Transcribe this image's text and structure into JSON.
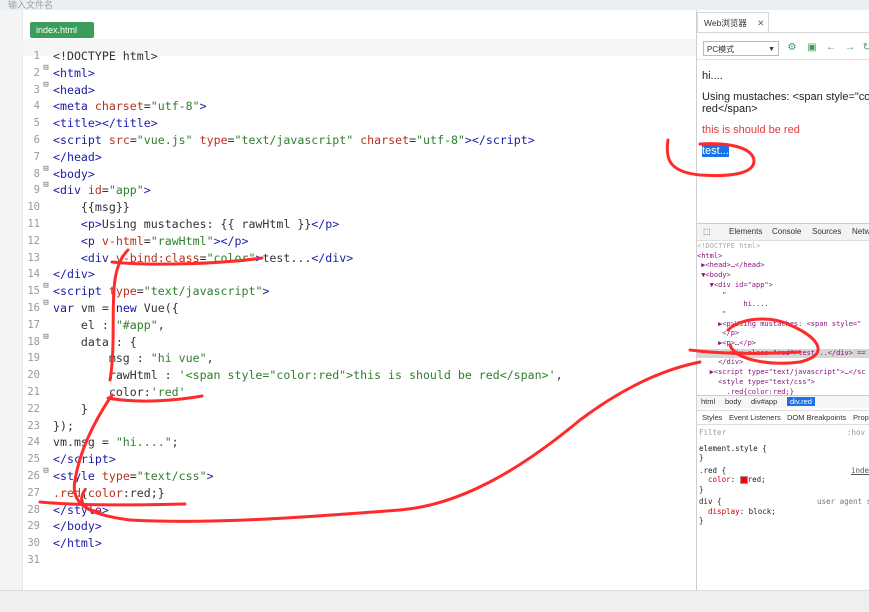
{
  "window": {
    "top_strip_text": "输入文件名"
  },
  "editor": {
    "tab_label": "index.html",
    "lines": [
      {
        "n": "1",
        "fold": "",
        "html": "&lt;!DOCTYPE html&gt;"
      },
      {
        "n": "2",
        "fold": "⊟",
        "html": "<span class='t'>&lt;html&gt;</span>"
      },
      {
        "n": "3",
        "fold": "⊟",
        "html": "<span class='t'>&lt;head&gt;</span>"
      },
      {
        "n": "4",
        "fold": "",
        "html": "<span class='t'>&lt;meta</span> <span class='a'>charset</span>=<span class='s'>\"utf-8\"</span><span class='t'>&gt;</span>"
      },
      {
        "n": "5",
        "fold": "",
        "html": "<span class='t'>&lt;title&gt;&lt;/title&gt;</span>"
      },
      {
        "n": "6",
        "fold": "",
        "html": "<span class='t'>&lt;script</span> <span class='a'>src</span>=<span class='s'>\"vue.js\"</span> <span class='a'>type</span>=<span class='s'>\"text/javascript\"</span> <span class='a'>charset</span>=<span class='s'>\"utf-8\"</span><span class='t'>&gt;&lt;/script&gt;</span>"
      },
      {
        "n": "7",
        "fold": "",
        "html": "<span class='t'>&lt;/head&gt;</span>"
      },
      {
        "n": "8",
        "fold": "⊟",
        "html": "<span class='t'>&lt;body&gt;</span>"
      },
      {
        "n": "9",
        "fold": "⊟",
        "html": "<span class='t'>&lt;div</span> <span class='a'>id</span>=<span class='s'>\"app\"</span><span class='t'>&gt;</span>"
      },
      {
        "n": "10",
        "fold": "",
        "html": "    {{msg}}"
      },
      {
        "n": "11",
        "fold": "",
        "html": "    <span class='t'>&lt;p&gt;</span>Using mustaches: {{ rawHtml }}<span class='t'>&lt;/p&gt;</span>"
      },
      {
        "n": "12",
        "fold": "",
        "html": "    <span class='t'>&lt;p</span> <span class='a'>v-html</span>=<span class='s'>\"rawHtml\"</span><span class='t'>&gt;&lt;/p&gt;</span>"
      },
      {
        "n": "13",
        "fold": "",
        "html": "    <span class='t'>&lt;div</span> <span class='a'>v-bind:class</span>=<span class='s'>\"color\"</span><span class='t'>&gt;</span>test...<span class='t'>&lt;/div&gt;</span>"
      },
      {
        "n": "14",
        "fold": "",
        "html": "<span class='t'>&lt;/div&gt;</span>"
      },
      {
        "n": "15",
        "fold": "⊟",
        "html": "<span class='t'>&lt;script</span> <span class='a'>type</span>=<span class='s'>\"text/javascript\"</span><span class='t'>&gt;</span>"
      },
      {
        "n": "16",
        "fold": "⊟",
        "html": "<span class='k'>var</span> vm = <span class='k'>new</span> Vue({"
      },
      {
        "n": "17",
        "fold": "",
        "html": "    el : <span class='s'>\"#app\"</span>,"
      },
      {
        "n": "18",
        "fold": "⊟",
        "html": "    data : {"
      },
      {
        "n": "19",
        "fold": "",
        "html": "        msg : <span class='s'>\"hi vue\"</span>,"
      },
      {
        "n": "20",
        "fold": "",
        "html": "        rawHtml : <span class='s'>'&lt;span style=\"color:red\"&gt;this is should be red&lt;/span&gt;'</span>,"
      },
      {
        "n": "21",
        "fold": "",
        "html": "        color:<span class='s'>'red'</span>"
      },
      {
        "n": "22",
        "fold": "",
        "html": "    }"
      },
      {
        "n": "23",
        "fold": "",
        "html": "});"
      },
      {
        "n": "24",
        "fold": "",
        "html": "vm.msg = <span class='s'>\"hi....\"</span>;"
      },
      {
        "n": "25",
        "fold": "",
        "html": "<span class='t'>&lt;/script&gt;</span>"
      },
      {
        "n": "26",
        "fold": "⊟",
        "html": "<span class='t'>&lt;style</span> <span class='a'>type</span>=<span class='s'>\"text/css\"</span><span class='t'>&gt;</span>"
      },
      {
        "n": "27",
        "fold": "",
        "html": "<span class='a'>.red</span>{<span class='a'>color</span>:red;}"
      },
      {
        "n": "28",
        "fold": "",
        "html": "<span class='t'>&lt;/style&gt;</span>"
      },
      {
        "n": "29",
        "fold": "",
        "html": "<span class='t'>&lt;/body&gt;</span>"
      },
      {
        "n": "30",
        "fold": "",
        "html": "<span class='t'>&lt;/html&gt;</span>"
      },
      {
        "n": "31",
        "fold": "",
        "html": ""
      }
    ]
  },
  "browser": {
    "tab_label": "Web浏览器",
    "tab_close": "✕",
    "mode_select": "PC模式",
    "page": {
      "line1": "hi....",
      "line2": "Using mustaches: <span style=\"co",
      "line2b": "red</span>",
      "red_line": "this is should be red",
      "selected": "test..."
    }
  },
  "devtools": {
    "tabs": [
      "Elements",
      "Console",
      "Sources",
      "Netw"
    ],
    "dom_lines": [
      "<!DOCTYPE html>",
      "<html>",
      " ▶<head>…</head>",
      " ▼<body>",
      "   ▼<div id=\"app\">",
      "      \"",
      "           hi....",
      "      \"",
      "     ▶<p>Using mustaches: <span style=\"",
      "      </p>",
      "     ▶<p>…</p>",
      "       <div class=\"red\">test...</div> ==",
      "     </div>",
      "   ▶<script type=\"text/javascript\">…</sc",
      "     <style type=\"text/css\">",
      "       .red{color:red;}"
    ],
    "breadcrumbs": [
      "html",
      "body",
      "div#app",
      "div.red"
    ],
    "styles_tabs": [
      "Styles",
      "Event Listeners",
      "DOM Breakpoints",
      "Prop"
    ],
    "filter_placeholder": "Filter",
    "hov": ":hov",
    "style_rules": {
      "element_style": "element.style {",
      "close": "}",
      "red_selector": ".red {",
      "red_source": "inde",
      "red_prop": "color",
      "red_value": "red;",
      "div_selector": "div {",
      "div_source": "user agent s",
      "div_prop": "display",
      "div_value": "block;"
    }
  },
  "colors": {
    "annotation": "#ff2b2b",
    "tab_green": "#3c9c5a",
    "selection": "#1a73e8"
  }
}
